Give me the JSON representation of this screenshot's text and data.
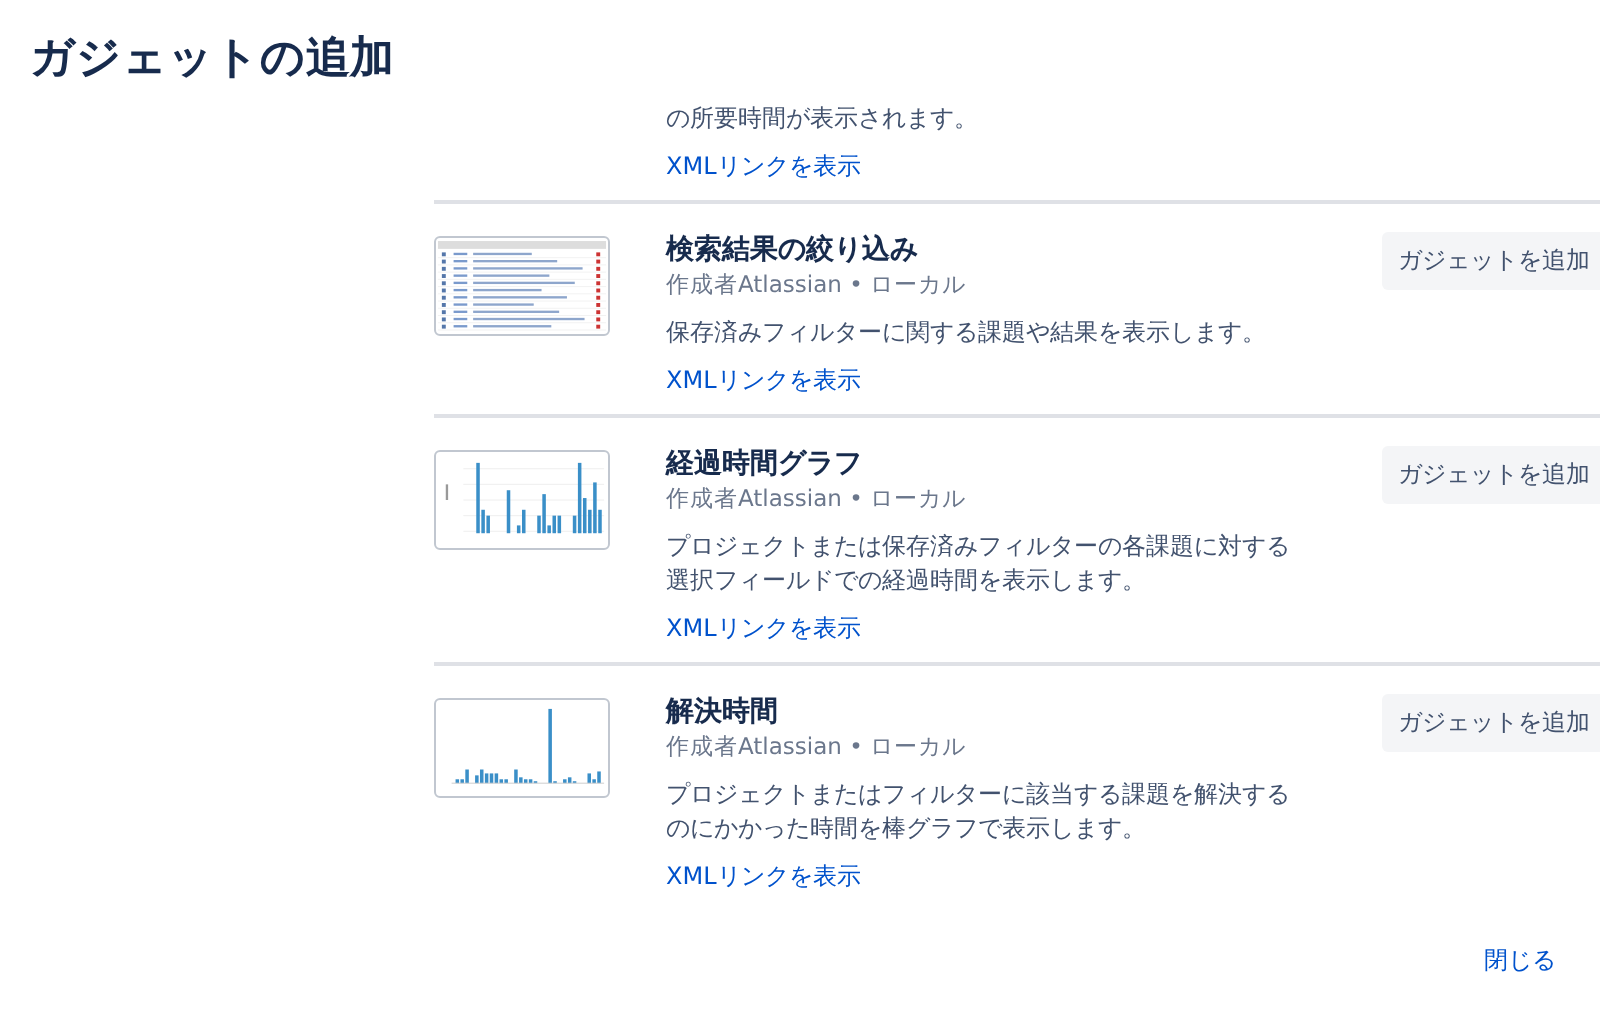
{
  "dialog": {
    "title": "ガジェットの追加"
  },
  "gadgets": [
    {
      "kind": "partial",
      "description": "の所要時間が表示されます。",
      "xml_link": "XMLリンクを表示"
    },
    {
      "kind": "table",
      "name": "検索結果の絞り込み",
      "author": "作成者Atlassian • ローカル",
      "add_button": "ガジェットを追加",
      "description": "保存済みフィルターに関する課題や結果を表示します。",
      "xml_link": "XMLリンクを表示"
    },
    {
      "kind": "bars",
      "name": "経過時間グラフ",
      "author": "作成者Atlassian • ローカル",
      "add_button": "ガジェットを追加",
      "description": "プロジェクトまたは保存済みフィルターの各課題に対する選択フィールドでの経過時間を表示します。",
      "xml_link": "XMLリンクを表示"
    },
    {
      "kind": "spike",
      "name": "解決時間",
      "author": "作成者Atlassian • ローカル",
      "add_button": "ガジェットを追加",
      "description": "プロジェクトまたはフィルターに該当する課題を解決するのにかかった時間を棒グラフで表示します。",
      "xml_link": "XMLリンクを表示"
    }
  ],
  "close_link": "閉じる"
}
